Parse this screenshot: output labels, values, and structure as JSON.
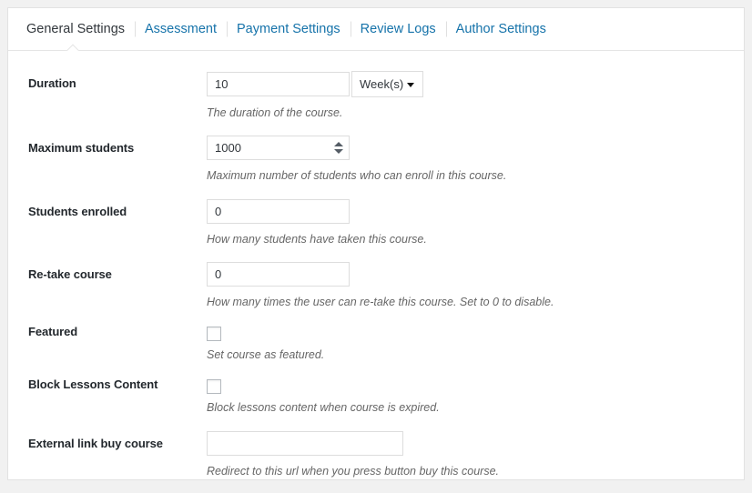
{
  "tabs": [
    {
      "label": "General Settings",
      "active": true
    },
    {
      "label": "Assessment",
      "active": false
    },
    {
      "label": "Payment Settings",
      "active": false
    },
    {
      "label": "Review Logs",
      "active": false
    },
    {
      "label": "Author Settings",
      "active": false
    }
  ],
  "fields": {
    "duration": {
      "label": "Duration",
      "value": "10",
      "unit_selected": "Week(s)",
      "unit_options": [
        "Week(s)"
      ],
      "description": "The duration of the course."
    },
    "maximum_students": {
      "label": "Maximum students",
      "value": "1000",
      "description": "Maximum number of students who can enroll in this course."
    },
    "students_enrolled": {
      "label": "Students enrolled",
      "value": "0",
      "description": "How many students have taken this course."
    },
    "retake_course": {
      "label": "Re-take course",
      "value": "0",
      "description": "How many times the user can re-take this course. Set to 0 to disable."
    },
    "featured": {
      "label": "Featured",
      "checked": false,
      "description": "Set course as featured."
    },
    "block_lessons_content": {
      "label": "Block Lessons Content",
      "checked": false,
      "description": "Block lessons content when course is expired."
    },
    "external_link_buy_course": {
      "label": "External link buy course",
      "value": "",
      "placeholder": "",
      "description": "Redirect to this url when you press button buy this course."
    }
  },
  "colors": {
    "page_background": "#f1f1f1",
    "panel_background": "#ffffff",
    "panel_border": "#e2e2e2",
    "tab_link": "#1673aa",
    "tab_active": "#32373c",
    "label_text": "#23282d",
    "description_text": "#666666",
    "input_border": "#dddddd"
  }
}
